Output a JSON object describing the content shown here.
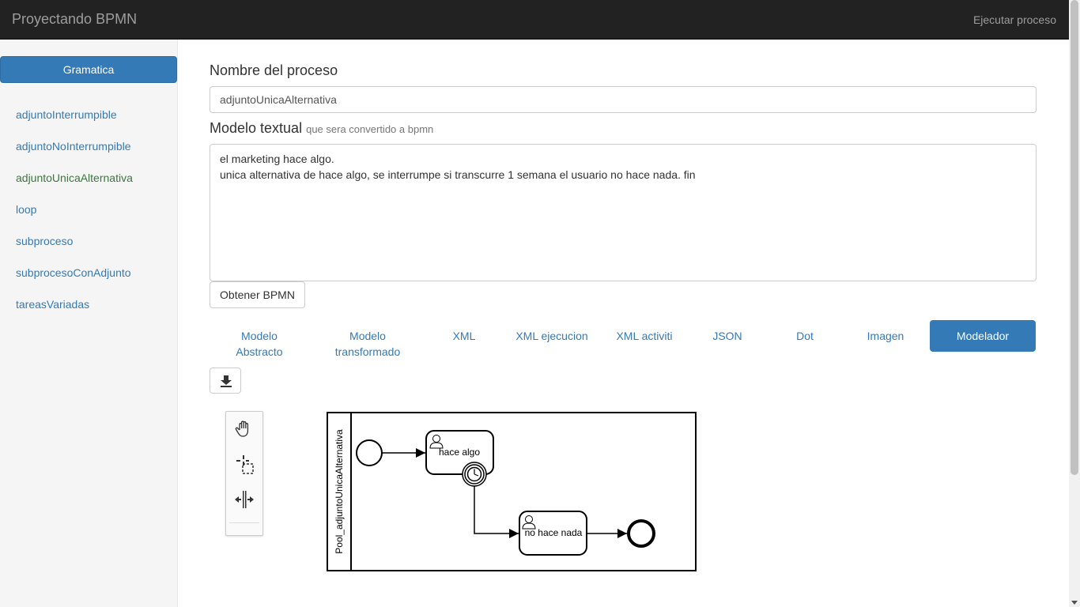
{
  "navbar": {
    "brand": "Proyectando BPMN",
    "right_link": "Ejecutar proceso"
  },
  "sidebar": {
    "header_button": "Gramatica",
    "items": [
      {
        "label": "adjuntoInterrumpible"
      },
      {
        "label": "adjuntoNoInterrumpible"
      },
      {
        "label": "adjuntoUnicaAlternativa"
      },
      {
        "label": "loop"
      },
      {
        "label": "subproceso"
      },
      {
        "label": "subprocesoConAdjunto"
      },
      {
        "label": "tareasVariadas"
      }
    ],
    "active_item": "adjuntoUnicaAlternativa"
  },
  "form": {
    "nombre_label": "Nombre del proceso",
    "nombre_value": "adjuntoUnicaAlternativa",
    "modelo_label": "Modelo textual",
    "modelo_sublabel": "que sera convertido a bpmn",
    "modelo_lines": [
      "el marketing hace algo.",
      "unica alternativa de hace algo, se interrumpe si transcurre 1 semana el usuario no hace nada. fin"
    ],
    "obtener_button": "Obtener BPMN"
  },
  "tabs": [
    {
      "label_1": "Modelo",
      "label_2": "Abstracto"
    },
    {
      "label_1": "Modelo",
      "label_2": "transformado"
    },
    {
      "label_1": "XML"
    },
    {
      "label_1": "XML ejecucion"
    },
    {
      "label_1": "XML activiti"
    },
    {
      "label_1": "JSON"
    },
    {
      "label_1": "Dot"
    },
    {
      "label_1": "Imagen"
    },
    {
      "label_1": "Modelador"
    }
  ],
  "active_tab": "Modelador",
  "toolbar_icons": {
    "download": "download-icon",
    "hand": "hand-tool-icon",
    "lasso": "lasso-tool-icon",
    "space": "space-tool-icon"
  },
  "diagram": {
    "pool_label": "Pool_adjuntoUnicaAlternativa",
    "task_1": "hace algo",
    "task_2": "no hace nada"
  },
  "colors": {
    "primary": "#337ab7",
    "navbar": "#222222",
    "active_link": "#3c763d"
  }
}
